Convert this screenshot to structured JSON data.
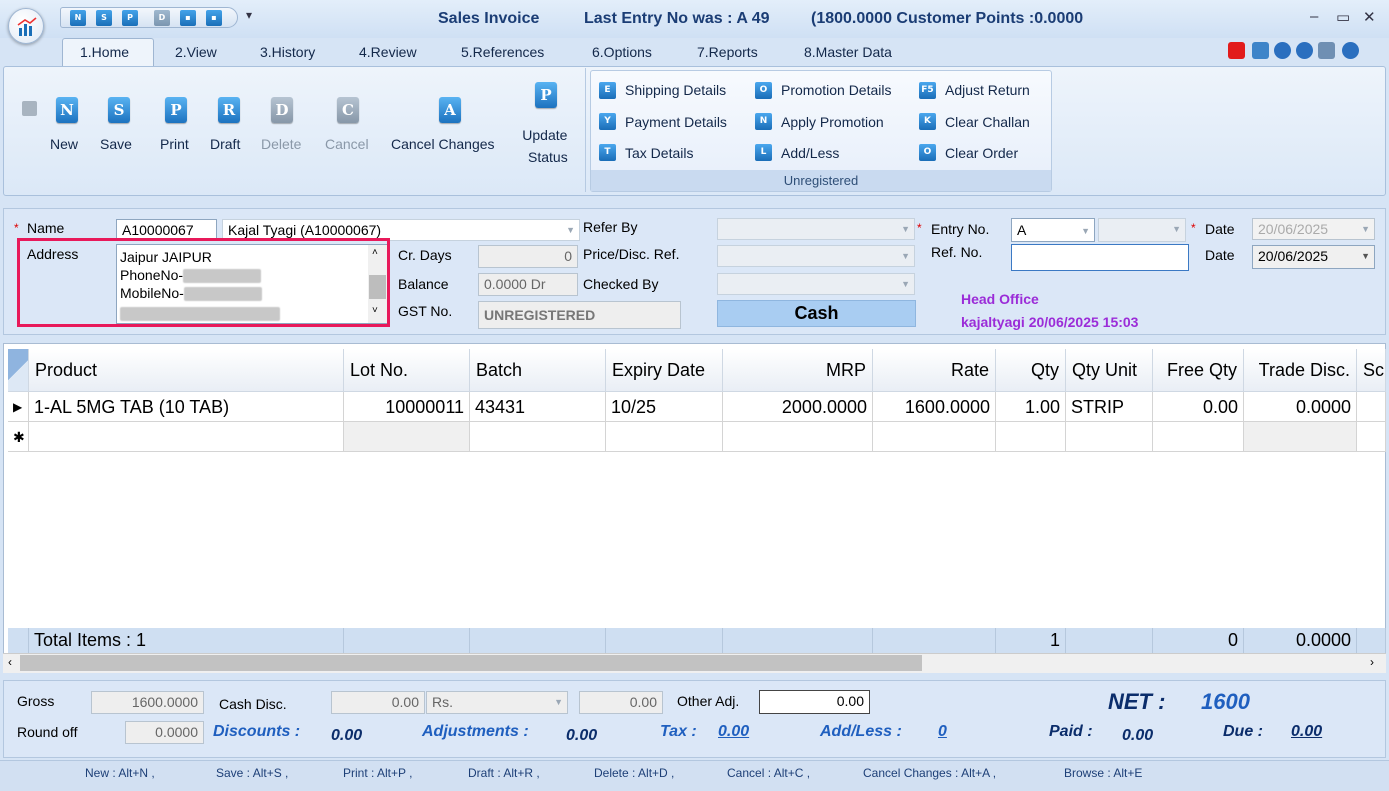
{
  "titlebar": {
    "title": "Sales Invoice",
    "last_entry": "Last Entry No was : A 49",
    "points": "(1800.0000  Customer Points :0.0000",
    "qat_icons": [
      "N",
      "S",
      "P",
      "D",
      "▪",
      "▪"
    ]
  },
  "tabs": [
    "1.Home",
    "2.View",
    "3.History",
    "4.Review",
    "5.References",
    "6.Options",
    "7.Reports",
    "8.Master Data"
  ],
  "ribbon": {
    "main_buttons": [
      {
        "icon": "N",
        "label": "New",
        "enabled": true
      },
      {
        "icon": "S",
        "label": "Save",
        "enabled": true
      },
      {
        "icon": "P",
        "label": "Print",
        "enabled": true
      },
      {
        "icon": "R",
        "label": "Draft",
        "enabled": true
      },
      {
        "icon": "D",
        "label": "Delete",
        "enabled": false
      },
      {
        "icon": "C",
        "label": "Cancel",
        "enabled": false
      },
      {
        "icon": "A",
        "label": "Cancel Changes",
        "enabled": true
      }
    ],
    "update_status": {
      "icon": "P",
      "label_line1": "Update",
      "label_line2": "Status"
    },
    "options": [
      {
        "icon": "E",
        "label": "Shipping Details"
      },
      {
        "icon": "Y",
        "label": "Payment Details"
      },
      {
        "icon": "T",
        "label": "Tax Details"
      },
      {
        "icon": "O",
        "label": "Promotion Details"
      },
      {
        "icon": "N",
        "label": "Apply Promotion"
      },
      {
        "icon": "L",
        "label": "Add/Less"
      },
      {
        "icon": "F5",
        "label": "Adjust Return"
      },
      {
        "icon": "K",
        "label": "Clear Challan"
      },
      {
        "icon": "O",
        "label": "Clear Order"
      }
    ],
    "group_footer": "Unregistered"
  },
  "form": {
    "name_label": "Name",
    "name_code": "A10000067",
    "name_value": "Kajal Tyagi (A10000067)",
    "address_label": "Address",
    "address_lines": [
      "Jaipur JAIPUR",
      "PhoneNo-",
      "MobileNo-"
    ],
    "cr_days_label": "Cr. Days",
    "cr_days_value": "0",
    "balance_label": "Balance",
    "balance_value": "0.0000 Dr",
    "gst_label": "GST No.",
    "gst_value": "UNREGISTERED",
    "refer_by_label": "Refer By",
    "price_disc_label": "Price/Disc. Ref.",
    "checked_by_label": "Checked By",
    "cash_label": "Cash",
    "entry_no_label": "Entry No.",
    "entry_series": "A",
    "ref_no_label": "Ref. No.",
    "date_label": "Date",
    "date_value1": "20/06/2025",
    "date_value2": "20/06/2025",
    "office": "Head Office",
    "user_stamp": "kajaltyagi 20/06/2025 15:03"
  },
  "grid": {
    "columns": [
      "Product",
      "Lot No.",
      "Batch",
      "Expiry Date",
      "MRP",
      "Rate",
      "Qty",
      "Qty Unit",
      "Free Qty",
      "Trade Disc.",
      "Sc"
    ],
    "row": {
      "product": "1-AL 5MG TAB (10 TAB)",
      "lot": "10000011",
      "batch": "43431",
      "expiry": "10/25",
      "mrp": "2000.0000",
      "rate": "1600.0000",
      "qty": "1.00",
      "unit": "STRIP",
      "free_qty": "0.00",
      "trade_disc": "0.0000"
    },
    "totals": {
      "label": "Total Items : 1",
      "qty": "1",
      "free_qty": "0",
      "trade_disc": "0.0000"
    }
  },
  "footer": {
    "gross_label": "Gross",
    "gross_value": "1600.0000",
    "cash_disc_label": "Cash Disc.",
    "cash_disc_value": "0.00",
    "cash_disc_unit": "Rs.",
    "cash_disc_amount": "0.00",
    "other_adj_label": "Other Adj.",
    "other_adj_value": "0.00",
    "round_off_label": "Round off",
    "round_off_value": "0.0000",
    "discounts_label": "Discounts :",
    "discounts_value": "0.00",
    "adjustments_label": "Adjustments :",
    "adjustments_value": "0.00",
    "tax_label": "Tax :",
    "tax_value": "0.00",
    "addless_label": "Add/Less :",
    "addless_value": "0",
    "net_label": "NET :",
    "net_value": "1600",
    "paid_label": "Paid :",
    "paid_value": "0.00",
    "due_label": "Due :",
    "due_value": "0.00"
  },
  "shortcuts": [
    "New : Alt+N ,",
    "Save : Alt+S ,",
    "Print : Alt+P ,",
    "Draft : Alt+R ,",
    "Delete : Alt+D ,",
    "Cancel : Alt+C ,",
    "Cancel Changes : Alt+A ,",
    "Browse : Alt+E"
  ],
  "colors": {
    "accent": "#1a6fb8",
    "highlight": "#e8195a",
    "purple": "#9b2cd8",
    "net": "#1f5fbf"
  }
}
